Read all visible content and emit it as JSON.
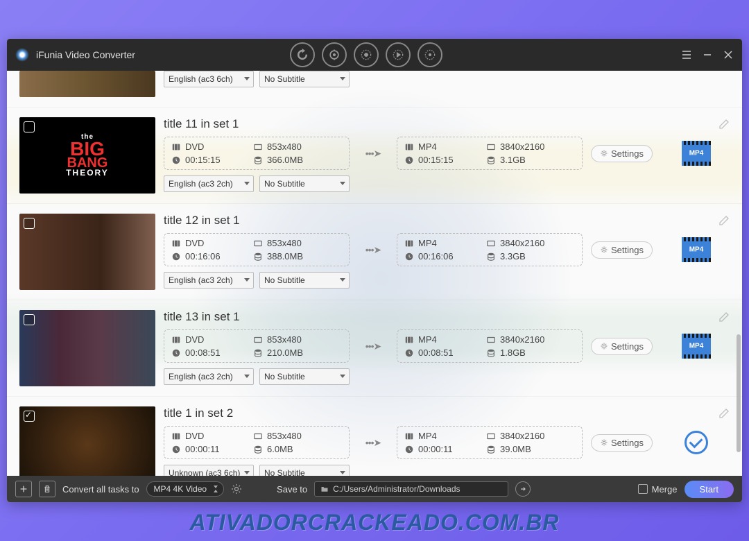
{
  "app": {
    "title": "iFunia Video Converter"
  },
  "items": [
    {
      "title": "",
      "checked": false,
      "src": {},
      "dst": {},
      "audio": "English (ac3 6ch)",
      "subtitle": "No Subtitle",
      "partial": true
    },
    {
      "title": "title 11 in set 1",
      "checked": false,
      "src": {
        "fmt": "DVD",
        "res": "853x480",
        "dur": "00:15:15",
        "size": "366.0MB"
      },
      "dst": {
        "fmt": "MP4",
        "res": "3840x2160",
        "dur": "00:15:15",
        "size": "3.1GB"
      },
      "audio": "English (ac3 2ch)",
      "subtitle": "No Subtitle",
      "status": "pending"
    },
    {
      "title": "title 12 in set 1",
      "checked": false,
      "src": {
        "fmt": "DVD",
        "res": "853x480",
        "dur": "00:16:06",
        "size": "388.0MB"
      },
      "dst": {
        "fmt": "MP4",
        "res": "3840x2160",
        "dur": "00:16:06",
        "size": "3.3GB"
      },
      "audio": "English (ac3 2ch)",
      "subtitle": "No Subtitle",
      "status": "pending"
    },
    {
      "title": "title 13 in set 1",
      "checked": false,
      "src": {
        "fmt": "DVD",
        "res": "853x480",
        "dur": "00:08:51",
        "size": "210.0MB"
      },
      "dst": {
        "fmt": "MP4",
        "res": "3840x2160",
        "dur": "00:08:51",
        "size": "1.8GB"
      },
      "audio": "English (ac3 2ch)",
      "subtitle": "No Subtitle",
      "status": "pending"
    },
    {
      "title": "title 1 in set 2",
      "checked": true,
      "src": {
        "fmt": "DVD",
        "res": "853x480",
        "dur": "00:00:11",
        "size": "6.0MB"
      },
      "dst": {
        "fmt": "MP4",
        "res": "3840x2160",
        "dur": "00:00:11",
        "size": "39.0MB"
      },
      "audio": "Unknown (ac3 6ch)",
      "subtitle": "No Subtitle",
      "status": "done"
    }
  ],
  "labels": {
    "settings": "Settings",
    "mp4": "MP4"
  },
  "footer": {
    "convert_label": "Convert all tasks to",
    "format": "MP4 4K Video",
    "save_label": "Save to",
    "save_path": "C:/Users/Administrator/Downloads",
    "merge": "Merge",
    "start": "Start"
  },
  "watermark": "ATIVADORCRACKEADO.COM.BR"
}
